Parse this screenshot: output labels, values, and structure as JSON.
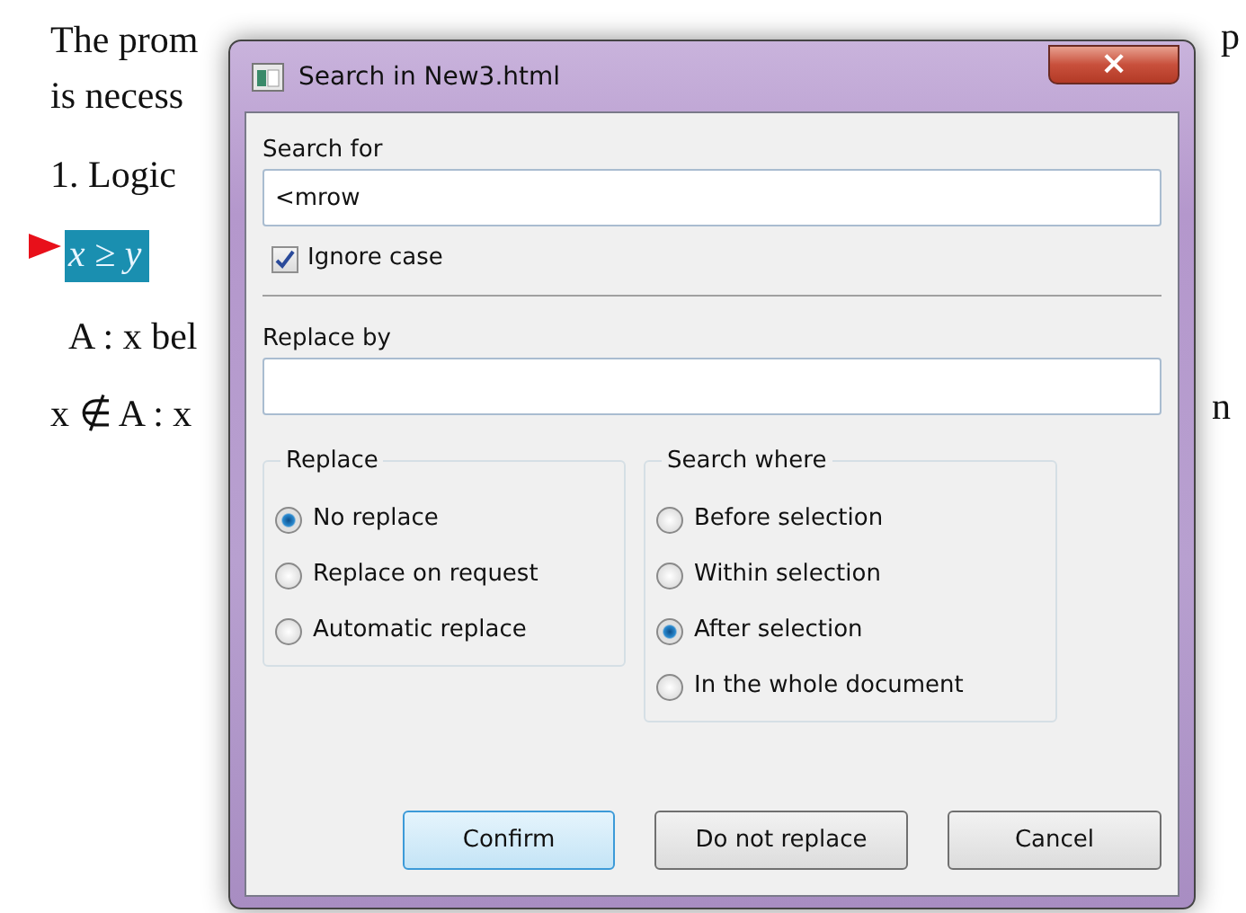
{
  "document": {
    "lines": [
      {
        "text": "The prom",
        "kind": "text"
      },
      {
        "text": "is necess",
        "kind": "text"
      },
      {
        "text": "1. Logic",
        "kind": "text"
      },
      {
        "text": "x ≥ y",
        "kind": "selection"
      },
      {
        "text": "A : x bel",
        "kind": "indent"
      },
      {
        "text": "x ∉ A : x",
        "kind": "text"
      }
    ],
    "right_fragments": [
      "p",
      "n"
    ]
  },
  "dialog": {
    "title": "Search in New3.html",
    "close": "×",
    "search_for": {
      "label": "Search for",
      "value": "<mrow"
    },
    "ignore_case": {
      "label": "Ignore case",
      "checked": true
    },
    "replace_by": {
      "label": "Replace by"
    },
    "groups": [
      {
        "title": "Replace",
        "options": [
          {
            "label": "No replace",
            "selected": true
          },
          {
            "label": "Replace on request",
            "selected": false
          },
          {
            "label": "Automatic replace",
            "selected": false
          }
        ]
      },
      {
        "title": "Search where",
        "options": [
          {
            "label": "Before selection",
            "selected": false
          },
          {
            "label": "Within selection",
            "selected": false
          },
          {
            "label": "After selection",
            "selected": true
          },
          {
            "label": "In the whole document",
            "selected": false
          }
        ]
      }
    ],
    "buttons": [
      {
        "label": "Confirm",
        "default": true
      },
      {
        "label": "Do not replace",
        "default": false
      },
      {
        "label": "Cancel",
        "default": false
      }
    ]
  }
}
